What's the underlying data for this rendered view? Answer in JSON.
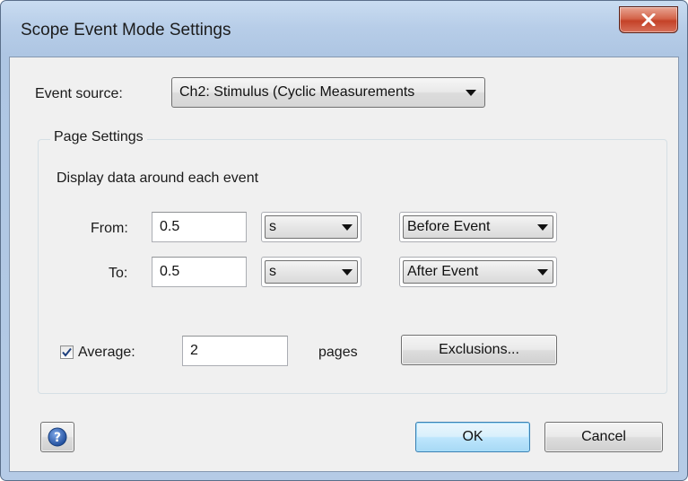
{
  "window": {
    "title": "Scope Event Mode Settings"
  },
  "event_source": {
    "label": "Event source:",
    "selected": "Ch2: Stimulus (Cyclic Measurements"
  },
  "page_settings": {
    "group_title": "Page Settings",
    "description": "Display data around each event",
    "from": {
      "label": "From:",
      "value": "0.5",
      "unit": "s",
      "position": "Before Event"
    },
    "to": {
      "label": "To:",
      "value": "0.5",
      "unit": "s",
      "position": "After Event"
    },
    "average": {
      "label": "Average:",
      "checked": true,
      "value": "2",
      "suffix": "pages"
    },
    "exclusions_label": "Exclusions..."
  },
  "footer": {
    "help_icon": "help-icon",
    "ok_label": "OK",
    "cancel_label": "Cancel"
  },
  "colors": {
    "accent": "#3c7fb1",
    "close_button": "#c44228",
    "help_icon": "#2b5aa8"
  }
}
